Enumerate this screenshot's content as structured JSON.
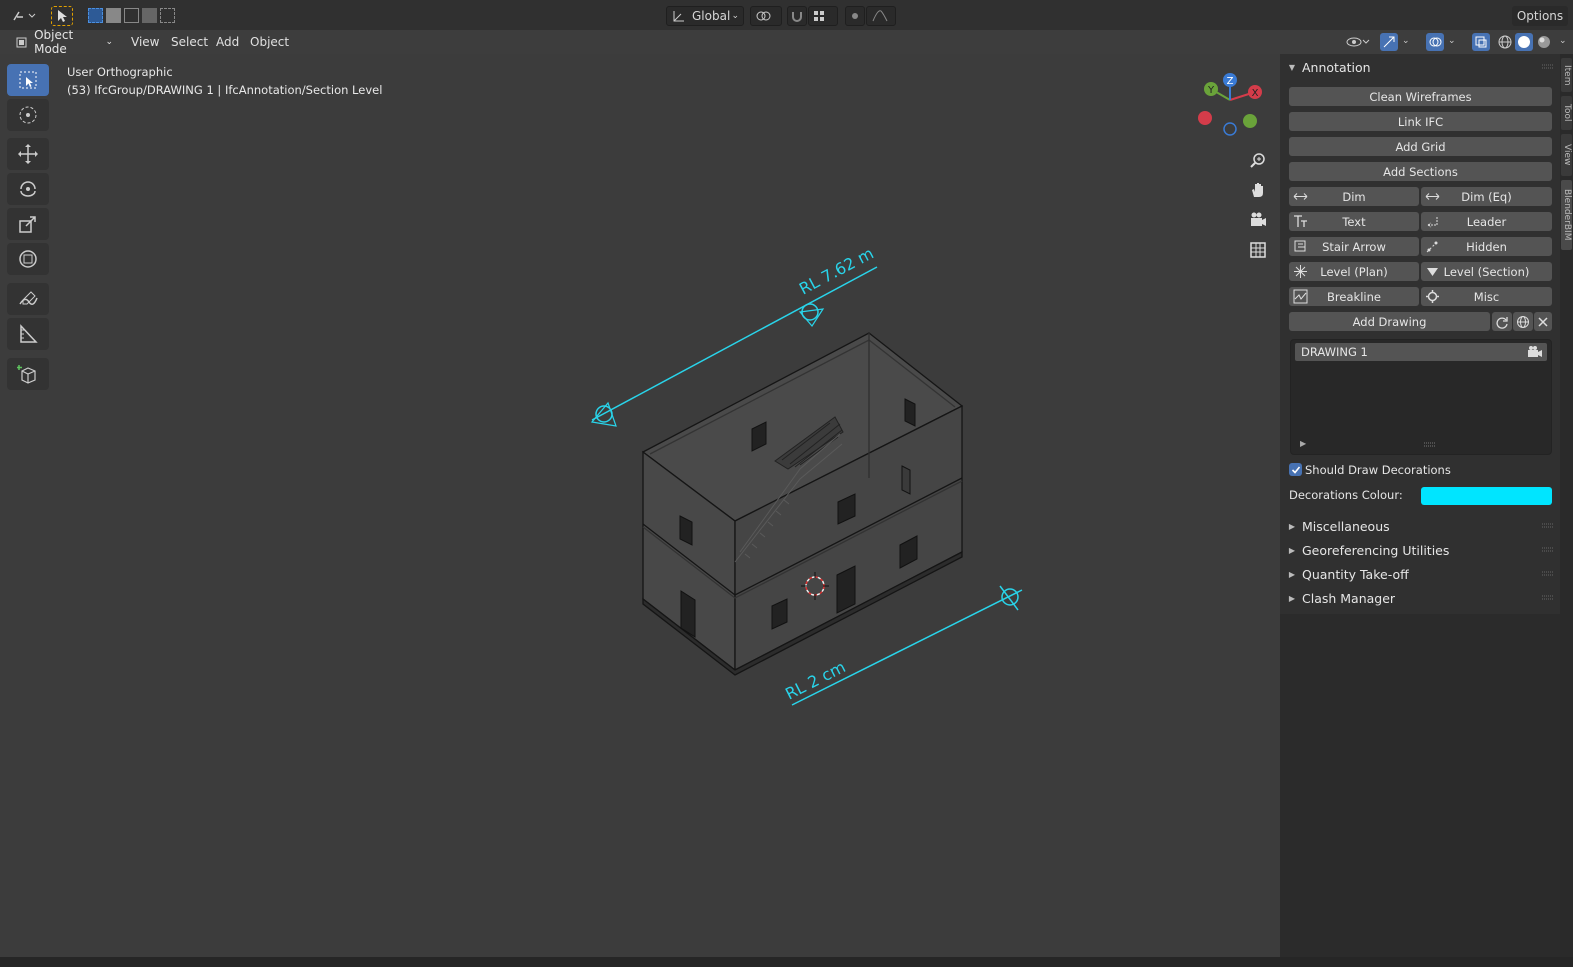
{
  "topbar": {
    "transform_orientation": "Global",
    "options_label": "Options"
  },
  "header": {
    "mode": "Object Mode",
    "menus": [
      "View",
      "Select",
      "Add",
      "Object"
    ]
  },
  "viewport": {
    "title_line1": "User Orthographic",
    "title_line2": "(53) IfcGroup/DRAWING 1 | IfcAnnotation/Section Level",
    "annotation_top": "RL 7.62 m",
    "annotation_bottom": "RL 2 cm",
    "gizmo": {
      "x": "X",
      "y": "Y",
      "z": "Z"
    },
    "annotation_color": "#2ad0e6"
  },
  "panel": {
    "title": "Annotation",
    "buttons_full": [
      "Clean Wireframes",
      "Link IFC",
      "Add Grid",
      "Add Sections"
    ],
    "buttons_pairs": [
      [
        "Dim",
        "Dim (Eq)"
      ],
      [
        "Text",
        "Leader"
      ],
      [
        "Stair Arrow",
        "Hidden"
      ],
      [
        "Level (Plan)",
        "Level (Section)"
      ],
      [
        "Breakline",
        "Misc"
      ]
    ],
    "add_drawing": "Add Drawing",
    "drawings": [
      "DRAWING 1"
    ],
    "should_draw_label": "Should Draw Decorations",
    "should_draw_checked": true,
    "decorations_colour_label": "Decorations Colour:",
    "decorations_colour": "#00e5ff",
    "sections": [
      "Miscellaneous",
      "Georeferencing Utilities",
      "Quantity Take-off",
      "Clash Manager"
    ]
  },
  "sidetabs": [
    "Item",
    "Tool",
    "View",
    "BlenderBIM"
  ]
}
